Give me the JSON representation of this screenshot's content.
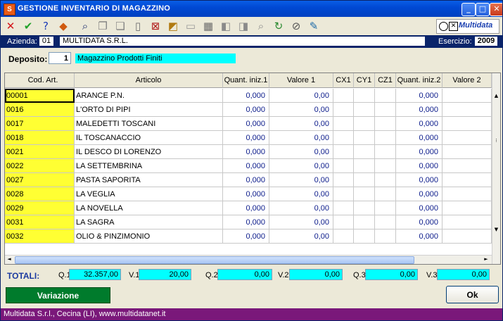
{
  "window": {
    "title": "GESTIONE INVENTARIO DI MAGAZZINO",
    "app_icon": "S"
  },
  "window_buttons": {
    "minimize": "_",
    "maximize": "□",
    "close": "✕"
  },
  "toolbar": {
    "icons": [
      "delete-icon",
      "confirm-icon",
      "help-icon",
      "tools-icon",
      "binoculars-icon",
      "copy-icon",
      "paste-icon",
      "new-doc-icon",
      "delete-doc-icon",
      "edit-chart-icon",
      "keyboard-icon",
      "table-icon",
      "import-icon",
      "export-icon",
      "find-icon",
      "refresh-icon",
      "cancel-icon",
      "edit-note-icon"
    ],
    "glyphs": [
      "✕",
      "✔",
      "?",
      "◆",
      "⌕",
      "❐",
      "❏",
      "▯",
      "⊠",
      "◩",
      "▭",
      "▦",
      "◧",
      "◨",
      "⌕",
      "↻",
      "⊘",
      "✎"
    ],
    "colors": [
      "#d4141a",
      "#22a22a",
      "#1c3cb8",
      "#d05a10",
      "#1f2f70",
      "#808080",
      "#808080",
      "#707070",
      "#b01818",
      "#b07a10",
      "#9a9a9a",
      "#6a6a6a",
      "#8a8a8a",
      "#8a8a8a",
      "#8a8a8a",
      "#2a8a30",
      "#555555",
      "#1c6aa8"
    ]
  },
  "logo": {
    "text": "Multidata",
    "box_glyph": "✕"
  },
  "company_bar": {
    "azienda_label": "Azienda:",
    "azienda_code": "01",
    "azienda_name": "MULTIDATA S.R.L.",
    "esercizio_label": "Esercizio:",
    "esercizio_value": "2009"
  },
  "deposito": {
    "label": "Deposito:",
    "number": "1",
    "name": "Magazzino Prodotti Finiti"
  },
  "grid": {
    "sort_indicator": "△",
    "columns": [
      "Cod. Art.",
      "Articolo",
      "Quant. iniz.1",
      "Valore 1",
      "CX1",
      "CY1",
      "CZ1",
      "Quant. iniz.2",
      "Valore 2"
    ],
    "rows": [
      {
        "code": "00001",
        "article": "ARANCE P.N.",
        "q1": "0,000",
        "v1": "0,00",
        "q2": "0,000"
      },
      {
        "code": "0016",
        "article": "L'ORTO DI PIPI",
        "q1": "0,000",
        "v1": "0,00",
        "q2": "0,000"
      },
      {
        "code": "0017",
        "article": "MALEDETTI TOSCANI",
        "q1": "0,000",
        "v1": "0,00",
        "q2": "0,000"
      },
      {
        "code": "0018",
        "article": "IL TOSCANACCIO",
        "q1": "0,000",
        "v1": "0,00",
        "q2": "0,000"
      },
      {
        "code": "0021",
        "article": "IL DESCO DI LORENZO",
        "q1": "0,000",
        "v1": "0,00",
        "q2": "0,000"
      },
      {
        "code": "0022",
        "article": "LA SETTEMBRINA",
        "q1": "0,000",
        "v1": "0,00",
        "q2": "0,000"
      },
      {
        "code": "0027",
        "article": "PASTA SAPORITA",
        "q1": "0,000",
        "v1": "0,00",
        "q2": "0,000"
      },
      {
        "code": "0028",
        "article": "LA VEGLIA",
        "q1": "0,000",
        "v1": "0,00",
        "q2": "0,000"
      },
      {
        "code": "0029",
        "article": "LA NOVELLA",
        "q1": "0,000",
        "v1": "0,00",
        "q2": "0,000"
      },
      {
        "code": "0031",
        "article": "LA SAGRA",
        "q1": "0,000",
        "v1": "0,00",
        "q2": "0,000"
      },
      {
        "code": "0032",
        "article": "OLIO & PINZIMONIO",
        "q1": "0,000",
        "v1": "0,00",
        "q2": "0,000"
      }
    ],
    "scroll": {
      "up": "▲",
      "down": "▼",
      "left": "◄",
      "right": "►",
      "grip": "⁝"
    }
  },
  "totals": {
    "label": "TOTALI:",
    "items": [
      {
        "label": "Q.1",
        "value": "32.357,00"
      },
      {
        "label": "V.1",
        "value": "20,00"
      },
      {
        "label": "Q.2",
        "value": "0,00"
      },
      {
        "label": "V.2",
        "value": "0,00"
      },
      {
        "label": "Q.3",
        "value": "0,00"
      },
      {
        "label": "V.3",
        "value": "0,00"
      }
    ]
  },
  "buttons": {
    "variazione": "Variazione",
    "ok": "Ok"
  },
  "status": {
    "text": "Multidata S.r.l., Cecina (LI), www.multidatanet.it"
  },
  "colors": {
    "title_bar": "#0049d4",
    "code_cell": "#ffff33",
    "cyan_field": "#00ffff",
    "status_bar": "#7a187a",
    "variazione_btn": "#007b2c"
  }
}
